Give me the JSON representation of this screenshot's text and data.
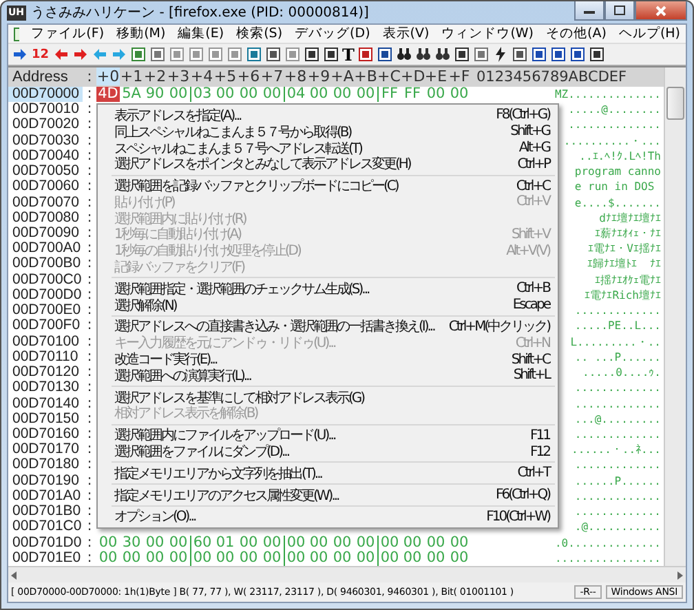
{
  "window": {
    "app_icon": "UH",
    "title": "うさみみハリケーン - [firefox.exe  (PID: 00000814)]"
  },
  "menubar": [
    {
      "label": "ファイル(F)"
    },
    {
      "label": "移動(M)"
    },
    {
      "label": "編集(E)"
    },
    {
      "label": "検索(S)"
    },
    {
      "label": "デバッグ(D)"
    },
    {
      "label": "表示(V)"
    },
    {
      "label": "ウィンドウ(W)"
    },
    {
      "label": "その他(A)"
    },
    {
      "label": "ヘルプ(H)"
    }
  ],
  "toolbar": {
    "count_label": "12",
    "text_tool": "T"
  },
  "hex_view": {
    "address_heading": "Address",
    "heading_separator": ":",
    "columns": [
      {
        "label": "+0",
        "selected": true
      },
      {
        "label": "+1",
        "selected": false
      },
      {
        "label": "+2",
        "selected": false
      },
      {
        "label": "+3",
        "selected": false
      },
      {
        "label": "+4",
        "selected": false
      },
      {
        "label": "+5",
        "selected": false
      },
      {
        "label": "+6",
        "selected": false
      },
      {
        "label": "+7",
        "selected": false
      },
      {
        "label": "+8",
        "selected": false
      },
      {
        "label": "+9",
        "selected": false
      },
      {
        "label": "+A",
        "selected": false
      },
      {
        "label": "+B",
        "selected": false
      },
      {
        "label": "+C",
        "selected": false
      },
      {
        "label": "+D",
        "selected": false
      },
      {
        "label": "+E",
        "selected": false
      },
      {
        "label": "+F",
        "selected": false
      }
    ],
    "ascii_heading": "0123456789ABCDEF",
    "rows": [
      {
        "address": "00D70000",
        "separator": ":",
        "selected": true,
        "bytes": [
          "4D",
          "5A",
          "90",
          "00",
          "03",
          "00",
          "00",
          "00",
          "04",
          "00",
          "00",
          "00",
          "FF",
          "FF",
          "00",
          "00"
        ],
        "ascii": "MZ.............."
      },
      {
        "address": "00D70010",
        "separator": ":",
        "selected": false,
        "ascii": ".....@........"
      },
      {
        "address": "00D70020",
        "separator": ":",
        "selected": false,
        "ascii": ".............."
      },
      {
        "address": "00D70030",
        "separator": ":",
        "selected": false,
        "ascii": "..........・..."
      },
      {
        "address": "00D70040",
        "separator": ":",
        "selected": false,
        "ascii": "..ｴ.ﾍ!ｸ.Lﾍ!Th"
      },
      {
        "address": "00D70050",
        "separator": ":",
        "selected": false,
        "ascii": "program canno"
      },
      {
        "address": "00D70060",
        "separator": ":",
        "selected": false,
        "ascii": "e run in DOS "
      },
      {
        "address": "00D70070",
        "separator": ":",
        "selected": false,
        "ascii": "e....$......."
      },
      {
        "address": "00D70080",
        "separator": ":",
        "selected": false,
        "ascii": " dﾅｴ壇ﾅｴ壇ﾅｴ"
      },
      {
        "address": "00D70090",
        "separator": ":",
        "selected": false,
        "ascii": "ｴ薪ﾅｴｵｨｪ・ﾅｴ"
      },
      {
        "address": "00D700A0",
        "separator": ":",
        "selected": false,
        "ascii": "ｴ電ﾅｴ・Vｴ揺ﾅｴ"
      },
      {
        "address": "00D700B0",
        "separator": ":",
        "selected": false,
        "ascii": "ｴ歸ﾅｴ壇ﾄｴ  ﾅｴ"
      },
      {
        "address": "00D700C0",
        "separator": ":",
        "selected": false,
        "ascii": "ｴ揺ﾅｴｵｹｪ電ﾅｴ"
      },
      {
        "address": "00D700D0",
        "separator": ":",
        "selected": false,
        "ascii": "ｴ電ﾅｴRich壇ﾅｴ"
      },
      {
        "address": "00D700E0",
        "separator": ":",
        "selected": false,
        "ascii": "............."
      },
      {
        "address": "00D700F0",
        "separator": ":",
        "selected": false,
        "ascii": ".....PE..L..."
      },
      {
        "address": "00D70100",
        "separator": ":",
        "selected": false,
        "ascii": "L.........・.."
      },
      {
        "address": "00D70110",
        "separator": ":",
        "selected": false,
        "ascii": ".. ...P......"
      },
      {
        "address": "00D70120",
        "separator": ":",
        "selected": false,
        "ascii": ".....0....ｩ."
      },
      {
        "address": "00D70130",
        "separator": ":",
        "selected": false,
        "ascii": "............."
      },
      {
        "address": "00D70140",
        "separator": ":",
        "selected": false,
        "ascii": "............."
      },
      {
        "address": "00D70150",
        "separator": ":",
        "selected": false,
        "ascii": "...@........."
      },
      {
        "address": "00D70160",
        "separator": ":",
        "selected": false,
        "ascii": "............."
      },
      {
        "address": "00D70170",
        "separator": ":",
        "selected": false,
        "ascii": "......・..ﾈ..."
      },
      {
        "address": "00D70180",
        "separator": ":",
        "selected": false,
        "ascii": "............."
      },
      {
        "address": "00D70190",
        "separator": ":",
        "selected": false,
        "ascii": "......P......"
      },
      {
        "address": "00D701A0",
        "separator": ":",
        "selected": false,
        "ascii": "............."
      },
      {
        "address": "00D701B0",
        "separator": ":",
        "selected": false,
        "ascii": "............."
      },
      {
        "address": "00D701C0",
        "separator": ":",
        "selected": false,
        "ascii": ".@..........."
      },
      {
        "address": "00D701D0",
        "separator": ":",
        "selected": false,
        "bytes": [
          "00",
          "30",
          "00",
          "00",
          "60",
          "01",
          "00",
          "00",
          "00",
          "00",
          "00",
          "00",
          "00",
          "00",
          "00",
          "00"
        ],
        "ascii": ".0.............."
      },
      {
        "address": "00D701E0",
        "separator": ":",
        "selected": false,
        "bytes": [
          "00",
          "00",
          "00",
          "00",
          "00",
          "00",
          "00",
          "00",
          "00",
          "00",
          "00",
          "00",
          "00",
          "00",
          "00",
          "00"
        ],
        "ascii": "................"
      }
    ]
  },
  "context_menu": [
    {
      "kind": "item",
      "label": "表示アドレスを指定(A)...",
      "shortcut": "F8(Ctrl+G)",
      "disabled": false
    },
    {
      "kind": "item",
      "label": "同上スペシャルねこまんま５７号から取得(B)",
      "shortcut": "Shift+G",
      "disabled": false
    },
    {
      "kind": "item",
      "label": "スペシャルねこまんま５７号へアドレス転送(T)",
      "shortcut": "Alt+G",
      "disabled": false
    },
    {
      "kind": "item",
      "label": "選択アドレスをポインタとみなして表示アドレス変更(H)",
      "shortcut": "Ctrl+P",
      "disabled": false
    },
    {
      "kind": "separator"
    },
    {
      "kind": "item",
      "label": "選択範囲を記録バッファとクリップボードにコピー(C)",
      "shortcut": "Ctrl+C",
      "disabled": false
    },
    {
      "kind": "item",
      "label": "貼り付け(P)",
      "shortcut": "Ctrl+V",
      "disabled": true
    },
    {
      "kind": "item",
      "label": "選択範囲内に貼り付け(R)",
      "disabled": true
    },
    {
      "kind": "item",
      "label": "1秒毎に自動貼り付け(A)",
      "shortcut": "Shift+V",
      "disabled": true
    },
    {
      "kind": "item",
      "label": "1秒毎の自動貼り付け処理を停止(D)",
      "shortcut": "Alt+V(V)",
      "disabled": true
    },
    {
      "kind": "item",
      "label": "記録バッファをクリア(F)",
      "disabled": true
    },
    {
      "kind": "separator"
    },
    {
      "kind": "item",
      "label": "選択範囲指定・選択範囲のチェックサム生成(S)...",
      "shortcut": "Ctrl+B",
      "disabled": false
    },
    {
      "kind": "item",
      "label": "選択解除(N)",
      "shortcut": "Escape",
      "disabled": false
    },
    {
      "kind": "separator"
    },
    {
      "kind": "item",
      "label": "選択アドレスへの直接書き込み・選択範囲の一括書き換え(I)...",
      "shortcut": "Ctrl+M(中クリック)",
      "disabled": false
    },
    {
      "kind": "item",
      "label": "キー入力履歴を元にアンドゥ・リドゥ(U)...",
      "shortcut": "Ctrl+N",
      "disabled": true
    },
    {
      "kind": "item",
      "label": "改造コード実行(E)...",
      "shortcut": "Shift+C",
      "disabled": false
    },
    {
      "kind": "item",
      "label": "選択範囲への演算実行(L)...",
      "shortcut": "Shift+L",
      "disabled": false
    },
    {
      "kind": "separator"
    },
    {
      "kind": "item",
      "label": "選択アドレスを基準にして相対アドレス表示(G)",
      "disabled": false
    },
    {
      "kind": "item",
      "label": "相対アドレス表示を解除(B)",
      "disabled": true
    },
    {
      "kind": "separator"
    },
    {
      "kind": "item",
      "label": "選択範囲内にファイルをアップロード(U)...",
      "shortcut": "F11",
      "disabled": false
    },
    {
      "kind": "item",
      "label": "選択範囲をファイルにダンプ(D)...",
      "shortcut": "F12",
      "disabled": false
    },
    {
      "kind": "separator"
    },
    {
      "kind": "item",
      "label": "指定メモリエリアから文字列を抽出(T)...",
      "shortcut": "Ctrl+T",
      "disabled": false
    },
    {
      "kind": "separator"
    },
    {
      "kind": "item",
      "label": "指定メモリエリアのアクセス属性変更(W)...",
      "shortcut": "F6(Ctrl+Q)",
      "disabled": false
    },
    {
      "kind": "separator"
    },
    {
      "kind": "item",
      "label": "オプション(O)...",
      "shortcut": "F10(Ctrl+W)",
      "disabled": false
    }
  ],
  "status_bar": {
    "selection": "[ 00D70000-00D70000: 1h(1)Byte ]  B( 77, 77 ), W( 23117, 23117 ), D( 9460301, 9460301 ), Bit( 01001101 )",
    "mode": "-R--",
    "encoding": "Windows ANSI"
  }
}
